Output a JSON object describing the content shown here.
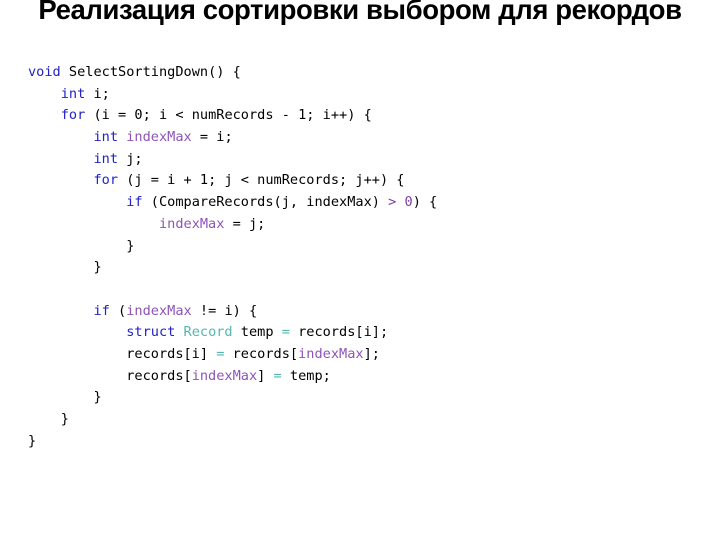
{
  "slide": {
    "title": "Реализация сортировки выбором для рекордов",
    "background_color": "#ffffff"
  },
  "colors": {
    "keyword": "#2222c8",
    "variable": "#8e54b8",
    "number": "#7a3fa8",
    "type": "#53b7b0",
    "operator_eq": "#53b7b0",
    "plain": "#000000",
    "title": "#000000"
  },
  "code": {
    "language": "c",
    "plain_text": "void SelectSortingDown() {\n    int i;\n    for (i = 0; i < numRecords - 1; i++) {\n        int indexMax = i;\n        int j;\n        for (j = i + 1; j < numRecords; j++) {\n            if (CompareRecords(j, indexMax) > 0) {\n                indexMax = j;\n            }\n        }\n\n        if (indexMax != i) {\n            struct Record temp = records[i];\n            records[i] = records[indexMax];\n            records[indexMax] = temp;\n        }\n    }\n}",
    "lines": [
      {
        "n": 1,
        "text": "void SelectSortingDown() {"
      },
      {
        "n": 2,
        "text": "    int i;"
      },
      {
        "n": 3,
        "text": "    for (i = 0; i < numRecords - 1; i++) {"
      },
      {
        "n": 4,
        "text": "        int indexMax = i;"
      },
      {
        "n": 5,
        "text": "        int j;"
      },
      {
        "n": 6,
        "text": "        for (j = i + 1; j < numRecords; j++) {"
      },
      {
        "n": 7,
        "text": "            if (CompareRecords(j, indexMax) > 0) {"
      },
      {
        "n": 8,
        "text": "                indexMax = j;"
      },
      {
        "n": 9,
        "text": "            }"
      },
      {
        "n": 10,
        "text": "        }"
      },
      {
        "n": 11,
        "text": ""
      },
      {
        "n": 12,
        "text": "        if (indexMax != i) {"
      },
      {
        "n": 13,
        "text": "            struct Record temp = records[i];"
      },
      {
        "n": 14,
        "text": "            records[i] = records[indexMax];"
      },
      {
        "n": 15,
        "text": "            records[indexMax] = temp;"
      },
      {
        "n": 16,
        "text": "        }"
      },
      {
        "n": 17,
        "text": "    }"
      },
      {
        "n": 18,
        "text": "}"
      }
    ],
    "tokens": {
      "l1": [
        {
          "t": "void",
          "c": "kw"
        },
        {
          "t": " SelectSortingDown() {",
          "c": "pl"
        }
      ],
      "l2": [
        {
          "t": "    ",
          "c": "pl"
        },
        {
          "t": "int",
          "c": "kw"
        },
        {
          "t": " i;",
          "c": "pl"
        }
      ],
      "l3": [
        {
          "t": "    ",
          "c": "pl"
        },
        {
          "t": "for",
          "c": "kw"
        },
        {
          "t": " (i = 0; i < numRecords - 1; i++) {",
          "c": "pl"
        }
      ],
      "l4": [
        {
          "t": "        ",
          "c": "pl"
        },
        {
          "t": "int",
          "c": "kw"
        },
        {
          "t": " ",
          "c": "pl"
        },
        {
          "t": "indexMax",
          "c": "var"
        },
        {
          "t": " = i;",
          "c": "pl"
        }
      ],
      "l5": [
        {
          "t": "        ",
          "c": "pl"
        },
        {
          "t": "int",
          "c": "kw"
        },
        {
          "t": " j;",
          "c": "pl"
        }
      ],
      "l6": [
        {
          "t": "        ",
          "c": "pl"
        },
        {
          "t": "for",
          "c": "kw"
        },
        {
          "t": " (j = i + 1; j < numRecords; j++) {",
          "c": "pl"
        }
      ],
      "l7": [
        {
          "t": "            ",
          "c": "pl"
        },
        {
          "t": "if",
          "c": "kw"
        },
        {
          "t": " (CompareRecords(j, indexMax) ",
          "c": "pl"
        },
        {
          "t": ">",
          "c": "op"
        },
        {
          "t": " ",
          "c": "pl"
        },
        {
          "t": "0",
          "c": "num"
        },
        {
          "t": ") {",
          "c": "pl"
        }
      ],
      "l8": [
        {
          "t": "                ",
          "c": "pl"
        },
        {
          "t": "indexMax",
          "c": "var"
        },
        {
          "t": " = j;",
          "c": "pl"
        }
      ],
      "l9": [
        {
          "t": "            }",
          "c": "pl"
        }
      ],
      "l10": [
        {
          "t": "        }",
          "c": "pl"
        }
      ],
      "l11": [
        {
          "t": "",
          "c": "pl"
        }
      ],
      "l12": [
        {
          "t": "        ",
          "c": "pl"
        },
        {
          "t": "if",
          "c": "kw"
        },
        {
          "t": " (",
          "c": "pl"
        },
        {
          "t": "indexMax",
          "c": "var"
        },
        {
          "t": " != i) {",
          "c": "pl"
        }
      ],
      "l13": [
        {
          "t": "            ",
          "c": "pl"
        },
        {
          "t": "struct",
          "c": "kw"
        },
        {
          "t": " ",
          "c": "pl"
        },
        {
          "t": "Record",
          "c": "type"
        },
        {
          "t": " temp ",
          "c": "pl"
        },
        {
          "t": "=",
          "c": "eq"
        },
        {
          "t": " records[i];",
          "c": "pl"
        }
      ],
      "l14": [
        {
          "t": "            records[i] ",
          "c": "pl"
        },
        {
          "t": "=",
          "c": "eq"
        },
        {
          "t": " records[",
          "c": "pl"
        },
        {
          "t": "indexMax",
          "c": "var"
        },
        {
          "t": "];",
          "c": "pl"
        }
      ],
      "l15": [
        {
          "t": "            records[",
          "c": "pl"
        },
        {
          "t": "indexMax",
          "c": "var"
        },
        {
          "t": "] ",
          "c": "pl"
        },
        {
          "t": "=",
          "c": "eq"
        },
        {
          "t": " temp;",
          "c": "pl"
        }
      ],
      "l16": [
        {
          "t": "        }",
          "c": "pl"
        }
      ],
      "l17": [
        {
          "t": "    }",
          "c": "pl"
        }
      ],
      "l18": [
        {
          "t": "}",
          "c": "pl"
        }
      ]
    }
  }
}
